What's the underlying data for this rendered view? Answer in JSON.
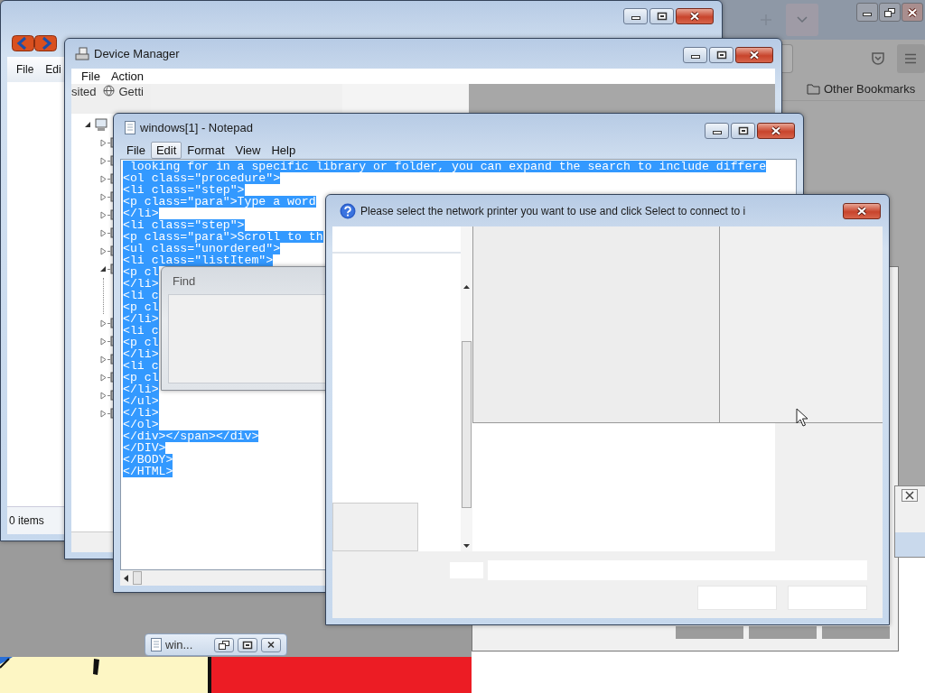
{
  "browser": {
    "bookmarks": [
      "Other Bookmarks"
    ]
  },
  "explorer": {
    "menu": [
      "File",
      "Edi"
    ],
    "status_bar": "0 items"
  },
  "device_manager": {
    "title": "Device Manager",
    "menu": [
      "File",
      "Action"
    ],
    "bookmarks_strip": [
      "sited",
      "Getti"
    ],
    "tree": {
      "expanded": true,
      "children": [
        {
          "expanded": false
        },
        {
          "expanded": false
        },
        {
          "expanded": false
        },
        {
          "expanded": false
        },
        {
          "expanded": false
        },
        {
          "expanded": false
        },
        {
          "expanded": false
        },
        {
          "expanded": true
        },
        {
          "expanded": false
        },
        {
          "expanded": false
        },
        {
          "expanded": false
        },
        {
          "expanded": false
        },
        {
          "expanded": false
        },
        {
          "expanded": false
        }
      ]
    }
  },
  "notepad": {
    "title": "windows[1] - Notepad",
    "menu": [
      {
        "label": "File",
        "selected": false
      },
      {
        "label": "Edit",
        "selected": true
      },
      {
        "label": "Format",
        "selected": false
      },
      {
        "label": "View",
        "selected": false
      },
      {
        "label": "Help",
        "selected": false
      }
    ],
    "selected": true,
    "lines": [
      " looking for in a specific library or folder, you can expand the search to include differe",
      "<ol class=\"procedure\">",
      "<li class=\"step\">",
      "<p class=\"para\">Type a word",
      "</li>",
      "<li class=\"step\">",
      "<p class=\"para\">Scroll to th",
      "<ul class=\"unordered\">",
      "<li class=\"listItem\">",
      "<p cl",
      "</li>",
      "<li c",
      "<p cl",
      "</li>",
      "<li c",
      "<p cl",
      "</li>",
      "<li c",
      "<p cl",
      "</li>",
      "</ul>",
      "</li>",
      "</ol>",
      "</div></span></div>",
      "</DIV>",
      "</BODY>",
      "</HTML>"
    ]
  },
  "find_dialog": {
    "title": "Find"
  },
  "printer_dialog": {
    "title": "Please select the network printer you want to use and click Select to connect to i"
  },
  "taskbar_thumbnail": {
    "title": "win..."
  }
}
